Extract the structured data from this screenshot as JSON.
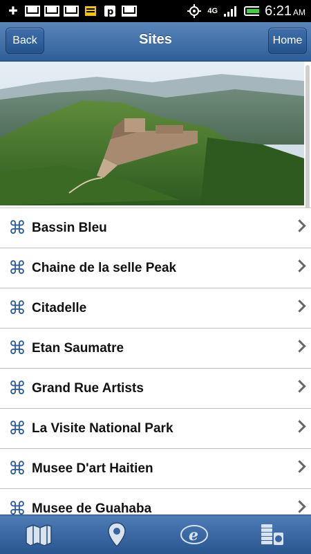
{
  "status_bar": {
    "time": "6:21",
    "ampm": "AM",
    "network": "4G",
    "icons": [
      "usb-icon",
      "gmail-icon",
      "gmail-icon",
      "mail-icon",
      "news-icon",
      "p-icon",
      "gmail-icon",
      "gps-icon",
      "network-4g-icon",
      "signal-icon",
      "battery-icon"
    ]
  },
  "header": {
    "title": "Sites",
    "back_label": "Back",
    "home_label": "Home"
  },
  "sites": [
    "Bassin Bleu",
    "Chaine de la selle Peak",
    "Citadelle",
    "Etan Saumatre",
    "Grand Rue Artists",
    "La Visite National Park",
    "Musee D'art Haitien",
    "Musee de Guahaba"
  ],
  "tabbar": {
    "icons": [
      "map-icon",
      "location-pin-icon",
      "e-logo-icon",
      "money-icon"
    ]
  }
}
